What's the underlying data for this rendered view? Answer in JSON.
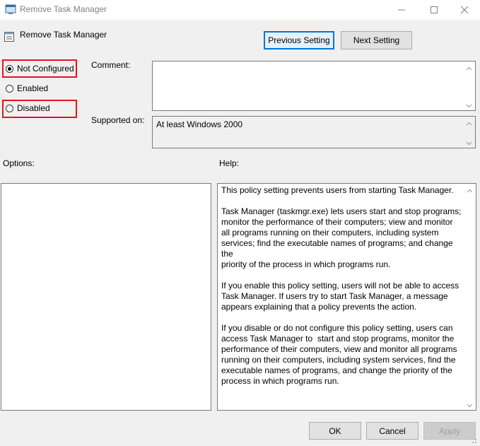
{
  "window": {
    "title": "Remove Task Manager",
    "minimize_icon": "minimize-icon",
    "maximize_icon": "maximize-icon",
    "close_icon": "close-icon"
  },
  "header": {
    "policy_name": "Remove Task Manager",
    "previous_label": "Previous Setting",
    "next_label": "Next Setting"
  },
  "state": {
    "options": [
      {
        "label": "Not Configured",
        "checked": true
      },
      {
        "label": "Enabled",
        "checked": false
      },
      {
        "label": "Disabled",
        "checked": false
      }
    ],
    "highlight_color": "#e81123"
  },
  "comment": {
    "label": "Comment:",
    "value": ""
  },
  "supported": {
    "label": "Supported on:",
    "value": "At least Windows 2000"
  },
  "options_panel": {
    "label": "Options:"
  },
  "help_panel": {
    "label": "Help:",
    "text": "This policy setting prevents users from starting Task Manager.\n\nTask Manager (taskmgr.exe) lets users start and stop programs;\nmonitor the performance of their computers; view and monitor\nall programs running on their computers, including system\nservices; find the executable names of programs; and change the\npriority of the process in which programs run.\n\nIf you enable this policy setting, users will not be able to access\nTask Manager. If users try to start Task Manager, a message\nappears explaining that a policy prevents the action.\n\nIf you disable or do not configure this policy setting, users can\naccess Task Manager to  start and stop programs, monitor the\nperformance of their computers, view and monitor all programs\nrunning on their computers, including system services, find the\nexecutable names of programs, and change the priority of the\nprocess in which programs run."
  },
  "footer": {
    "ok_label": "OK",
    "cancel_label": "Cancel",
    "apply_label": "Apply"
  }
}
